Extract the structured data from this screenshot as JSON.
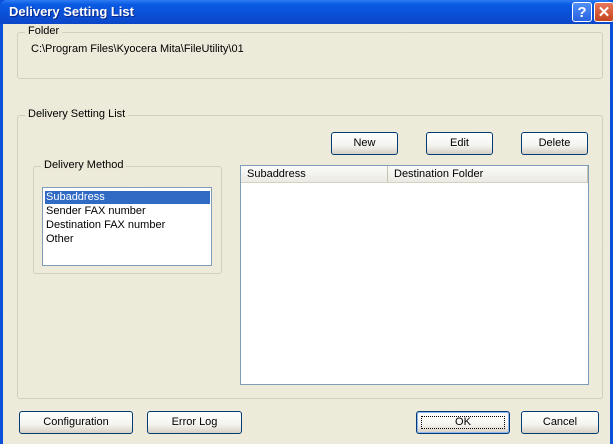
{
  "window": {
    "title": "Delivery Setting List",
    "help_glyph": "?",
    "close_glyph": "✕"
  },
  "folder": {
    "label": "Folder",
    "path": "C:\\Program Files\\Kyocera Mita\\FileUtility\\01"
  },
  "delivery_list": {
    "label": "Delivery Setting List",
    "buttons": {
      "new": "New",
      "edit": "Edit",
      "delete": "Delete"
    },
    "method": {
      "label": "Delivery Method",
      "options": [
        "Subaddress",
        "Sender FAX number",
        "Destination FAX number",
        "Other"
      ],
      "selected": "Subaddress"
    },
    "table": {
      "columns": [
        "Subaddress",
        "Destination Folder"
      ],
      "rows": []
    }
  },
  "footer": {
    "configuration": "Configuration",
    "error_log": "Error Log",
    "ok": "OK",
    "cancel": "Cancel"
  },
  "colors": {
    "titlebar": "#0a50d8",
    "dialog_bg": "#ece9d8",
    "selection": "#316ac5",
    "close_button": "#c4441f"
  }
}
